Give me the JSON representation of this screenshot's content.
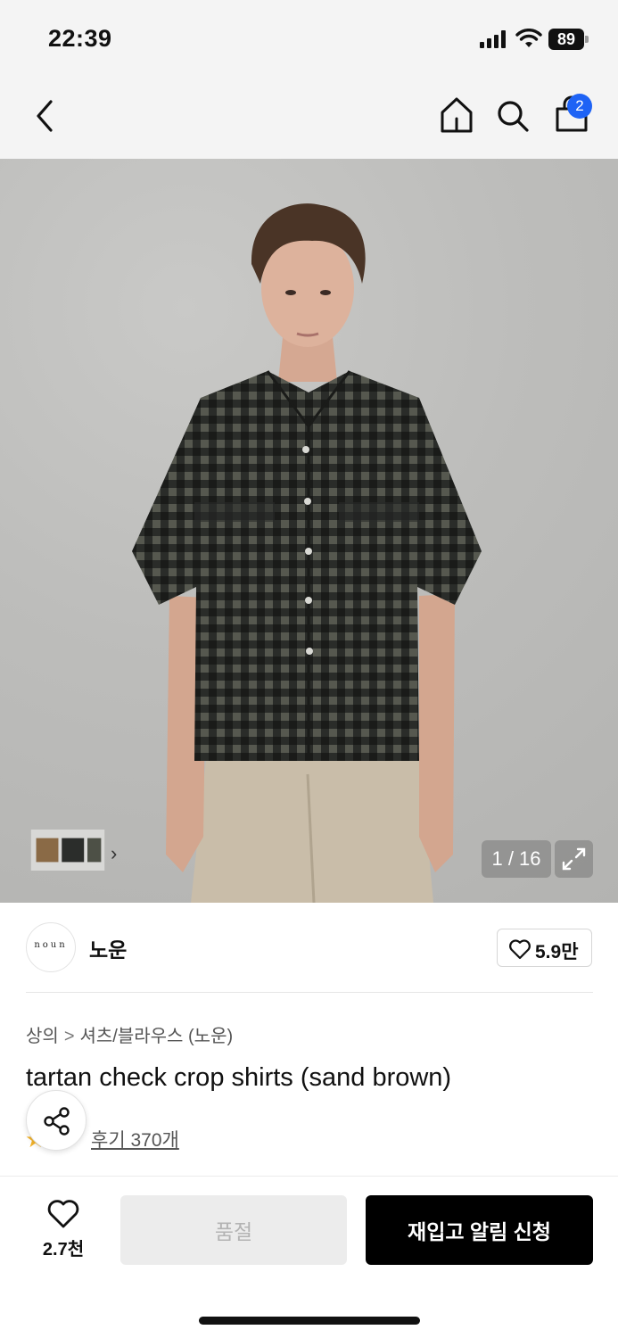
{
  "status_bar": {
    "time": "22:39",
    "battery": "89",
    "icons": [
      "signal-icon",
      "wifi-icon",
      "battery-icon"
    ]
  },
  "header": {
    "icons": [
      "back-icon",
      "home-icon",
      "search-icon",
      "shopping-bag-icon"
    ],
    "cart_count": "2"
  },
  "gallery": {
    "counter": "1 / 16",
    "thumbnail_chevron": "›",
    "icons": [
      "expand-icon",
      "chevron-right-icon"
    ]
  },
  "brand": {
    "logo_text": "noun",
    "name": "노운",
    "likes": "5.9만"
  },
  "product": {
    "breadcrumb": [
      "상의",
      "셔츠/블라우스 (노운)"
    ],
    "breadcrumb_separator": ">",
    "title": "tartan check crop shirts (sand brown)",
    "reviews": "후기 370개"
  },
  "bottom_bar": {
    "wish_count": "2.7천",
    "soldout_label": "품절",
    "restock_label": "재입고 알림 신청"
  },
  "colors": {
    "accent_badge": "#1e63f5",
    "primary_button": "#000000",
    "disabled_button": "#ececec",
    "rating_star": "#f3b32a"
  }
}
